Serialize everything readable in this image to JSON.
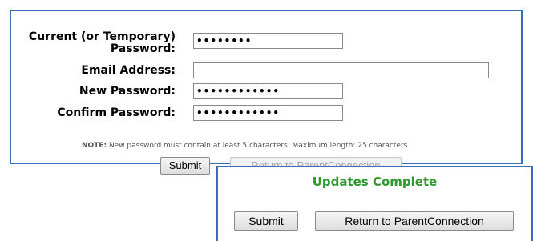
{
  "form": {
    "current_password": {
      "label_line1": "Current (or Temporary)",
      "label_line2": "Password:",
      "value": "••••••••"
    },
    "email": {
      "label": "Email Address:",
      "value": ""
    },
    "new_password": {
      "label": "New Password:",
      "value": "••••••••••••"
    },
    "confirm_password": {
      "label": "Confirm Password:",
      "value": "••••••••••••"
    },
    "note_prefix": "NOTE:",
    "note_text": " New password must contain at least 5 characters. Maximum length: 25 characters.",
    "submit_label": "Submit",
    "return_label": "Return to ParentConnection"
  },
  "popup": {
    "title": "Updates Complete",
    "submit_label": "Submit",
    "return_label": "Return to ParentConnection",
    "title_color": "#2e9a2e",
    "border_color": "#3a6fb7"
  }
}
